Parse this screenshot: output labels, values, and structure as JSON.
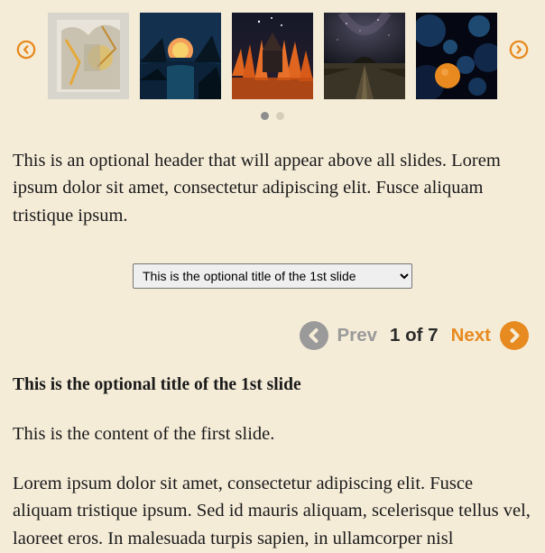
{
  "carousel": {
    "thumbs": [
      {
        "name": "thumb-1"
      },
      {
        "name": "thumb-2"
      },
      {
        "name": "thumb-3"
      },
      {
        "name": "thumb-4"
      },
      {
        "name": "thumb-5"
      }
    ],
    "dots": {
      "count": 2,
      "active": 0
    }
  },
  "header_text": "This is an optional header that will appear above all slides. Lorem ipsum dolor sit amet, consectetur adipiscing elit. Fusce aliquam tristique ipsum.",
  "select": {
    "selected": "This is the optional title of the 1st slide"
  },
  "pager": {
    "prev_label": "Prev",
    "count_label": "1 of 7",
    "next_label": "Next"
  },
  "slide": {
    "title": "This is the optional title of the 1st slide",
    "content_1": "This is the content of the first slide.",
    "content_2": "Lorem ipsum dolor sit amet, consectetur adipiscing elit. Fusce aliquam tristique ipsum. Sed id mauris aliquam, scelerisque tellus vel, laoreet eros. In malesuada turpis sapien, in ullamcorper nisl"
  },
  "colors": {
    "accent": "#e78a1f",
    "disabled": "#9a9a9a"
  }
}
